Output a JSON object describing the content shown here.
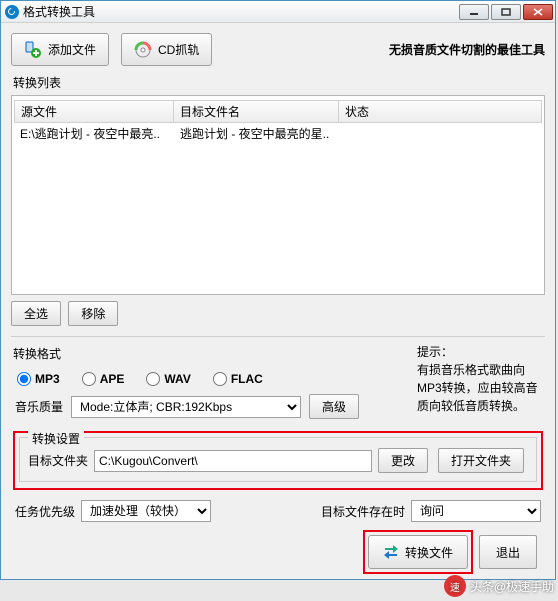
{
  "window": {
    "title": "格式转换工具"
  },
  "toolbar": {
    "add_file": "添加文件",
    "cd_grab": "CD抓轨",
    "slogan": "无损音质文件切割的最佳工具"
  },
  "list": {
    "label": "转换列表",
    "columns": {
      "source": "源文件",
      "target": "目标文件名",
      "status": "状态"
    },
    "rows": [
      {
        "source": "E:\\逃跑计划 - 夜空中最亮..",
        "target": "逃跑计划 - 夜空中最亮的星..",
        "status": ""
      }
    ],
    "select_all": "全选",
    "remove": "移除"
  },
  "format": {
    "label": "转换格式",
    "options": [
      "MP3",
      "APE",
      "WAV",
      "FLAC"
    ],
    "selected": "MP3",
    "quality_label": "音乐质量",
    "quality_mode": "Mode:立体声; CBR:192Kbps",
    "advanced": "高级",
    "tips_title": "提示：",
    "tips_body": "有损音乐格式歌曲向MP3转换，应由较高音质向较低音质转换。"
  },
  "settings": {
    "legend": "转换设置",
    "dest_label": "目标文件夹",
    "dest_value": "C:\\Kugou\\Convert\\",
    "change": "更改",
    "open": "打开文件夹"
  },
  "bottom": {
    "priority_label": "任务优先级",
    "priority_value": "加速处理（较快）",
    "exists_label": "目标文件存在时",
    "exists_value": "询问"
  },
  "actions": {
    "convert": "转换文件",
    "exit": "退出"
  },
  "watermark": {
    "source": "头条@极速手助"
  }
}
